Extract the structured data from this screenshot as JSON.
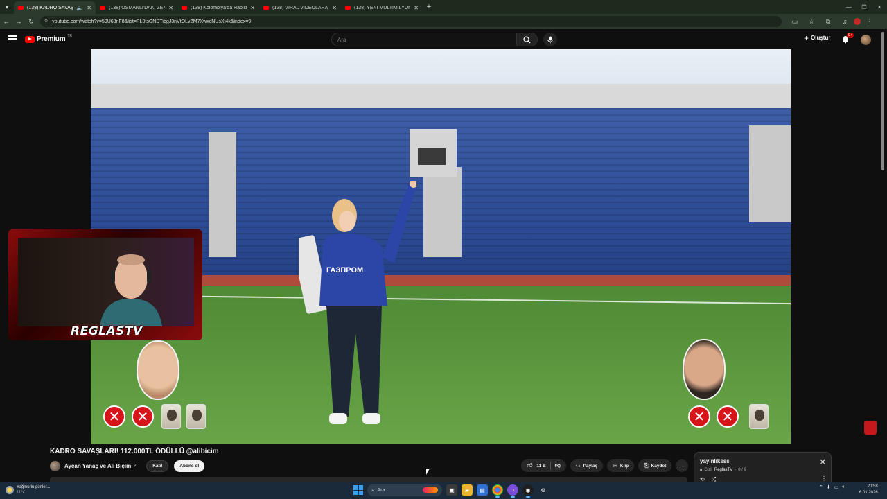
{
  "browser": {
    "tabs": [
      {
        "title": "(138) KADRO SAVAŞLARI! 1",
        "active": true
      },
      {
        "title": "(138) OSMANLI'DAKİ ZENGİN",
        "active": false
      },
      {
        "title": "(138) Kolombiya'da Hapishane",
        "active": false
      },
      {
        "title": "(138) VİRAL VİDEOLARA TEPKİ",
        "active": false
      },
      {
        "title": "(138) YENİ MULTİMİLYONER A",
        "active": false
      }
    ],
    "url": "youtube.com/watch?v=59U68nF8&list=PL0tsGNDTibgJ3nVtOLvZM7XwxcNUsXt4k&index=9"
  },
  "youtube": {
    "brand": "Premium",
    "region": "TR",
    "search_placeholder": "Ara",
    "create_label": "Oluştur",
    "notifications_badge": "9+"
  },
  "video": {
    "title": "KADRO SAVAŞLARI! 112.000TL ÖDÜLLÜ @alibicim",
    "channel": "Aycan Yanaç ve Ali Biçim",
    "verified_icon": "✔",
    "join_label": "Katıl",
    "subscribe_label": "Abone ol",
    "likes": "11 B",
    "share_label": "Paylaş",
    "clip_label": "Klip",
    "save_label": "Kaydet",
    "webcam_logo": "REGLASTV",
    "jersey_text": "ГАЗПРОМ"
  },
  "playlist": {
    "title": "yayınlıksss",
    "privacy": "Gizli",
    "owner": "ReglasTV",
    "position": "8 / 9"
  },
  "taskbar": {
    "weather_title": "Yağmurlu günler...",
    "weather_temp": "11°C",
    "search_placeholder": "Ara",
    "time": "20:58",
    "date": "6.01.2026"
  }
}
